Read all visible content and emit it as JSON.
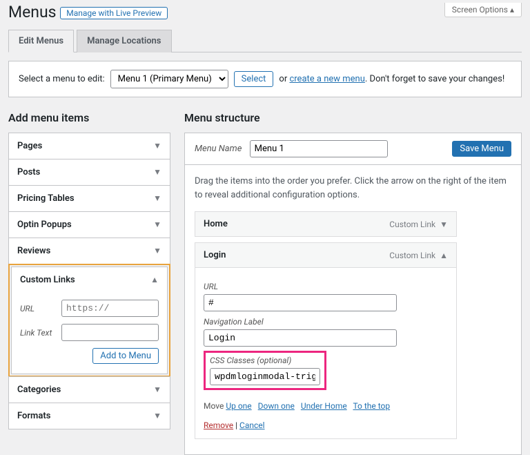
{
  "header": {
    "title": "Menus",
    "livePreview": "Manage with Live Preview",
    "screenOptions": "Screen Options"
  },
  "tabs": {
    "edit": "Edit Menus",
    "locations": "Manage Locations"
  },
  "selectbar": {
    "label": "Select a menu to edit:",
    "option": "Menu 1 (Primary Menu)",
    "select": "Select",
    "or": "or",
    "create": "create a new menu",
    "tail": ". Don't forget to save your changes!"
  },
  "left": {
    "heading": "Add menu items",
    "items": [
      "Pages",
      "Posts",
      "Pricing Tables",
      "Optin Popups",
      "Reviews"
    ],
    "custom": {
      "title": "Custom Links",
      "urlLabel": "URL",
      "urlPlaceholder": "https://",
      "textLabel": "Link Text",
      "add": "Add to Menu"
    },
    "after": [
      "Categories",
      "Formats"
    ]
  },
  "right": {
    "heading": "Menu structure",
    "nameLabel": "Menu Name",
    "nameValue": "Menu 1",
    "save": "Save Menu",
    "hint": "Drag the items into the order you prefer. Click the arrow on the right of the item to reveal additional configuration options.",
    "item1": {
      "title": "Home",
      "type": "Custom Link"
    },
    "item2": {
      "title": "Login",
      "type": "Custom Link",
      "urlLabel": "URL",
      "urlValue": "#",
      "navLabel": "Navigation Label",
      "navValue": "Login",
      "cssLabel": "CSS Classes (optional)",
      "cssValue": "wpdmloginmodal-trigger",
      "move": "Move",
      "up": "Up one",
      "down": "Down one",
      "under": "Under Home",
      "top": "To the top",
      "remove": "Remove",
      "cancel": "Cancel"
    }
  }
}
